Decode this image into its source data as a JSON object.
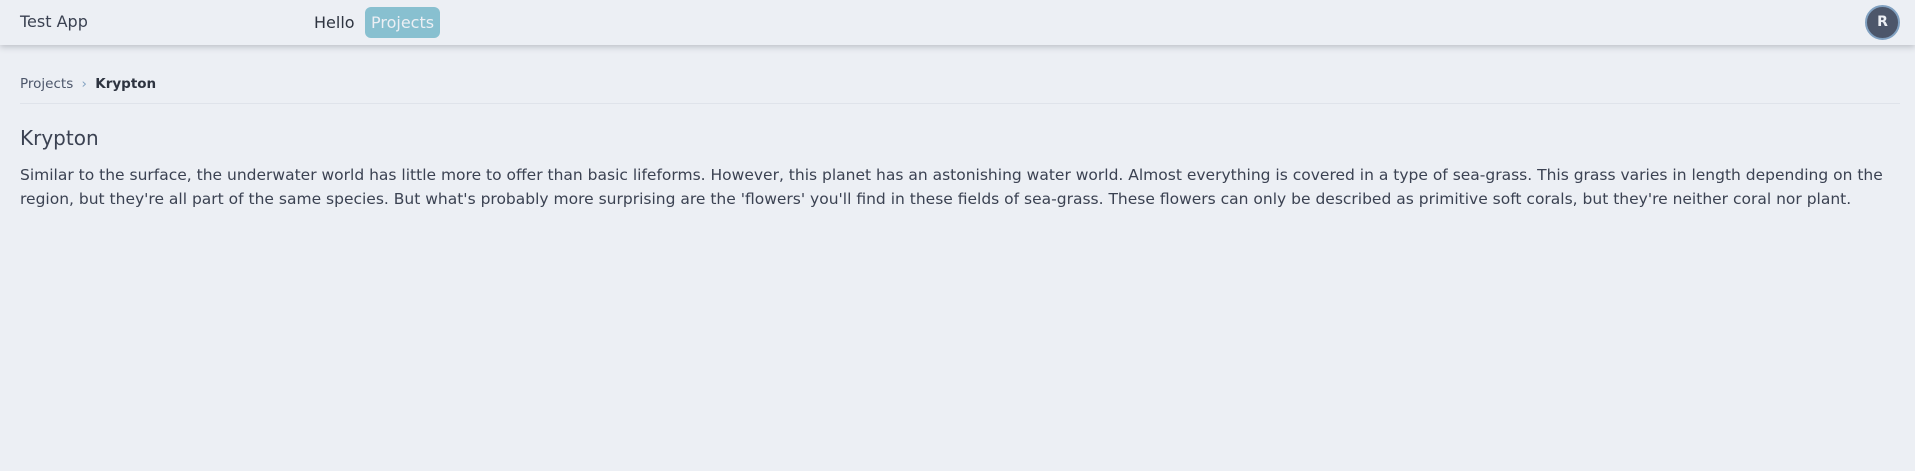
{
  "app": {
    "title": "Test App"
  },
  "nav": {
    "items": [
      {
        "label": "Hello",
        "active": false
      },
      {
        "label": "Projects",
        "active": true
      }
    ]
  },
  "user": {
    "avatar_initial": "R"
  },
  "breadcrumb": {
    "items": [
      {
        "label": "Projects"
      },
      {
        "label": "Krypton"
      }
    ],
    "separator": "›"
  },
  "project": {
    "title": "Krypton",
    "description": "Similar to the surface, the underwater world has little more to offer than basic lifeforms. However, this planet has an astonishing water world. Almost everything is covered in a type of sea-grass. This grass varies in length depending on the region, but they're all part of the same species. But what's probably more surprising are the 'flowers' you'll find in these fields of sea-grass. These flowers can only be described as primitive soft corals, but they're neither coral nor plant."
  },
  "colors": {
    "background": "#eceff4",
    "accent": "#88c0d0",
    "avatar": "#4c566a",
    "avatar_ring": "#81a1c1",
    "text": "#3b4252"
  }
}
